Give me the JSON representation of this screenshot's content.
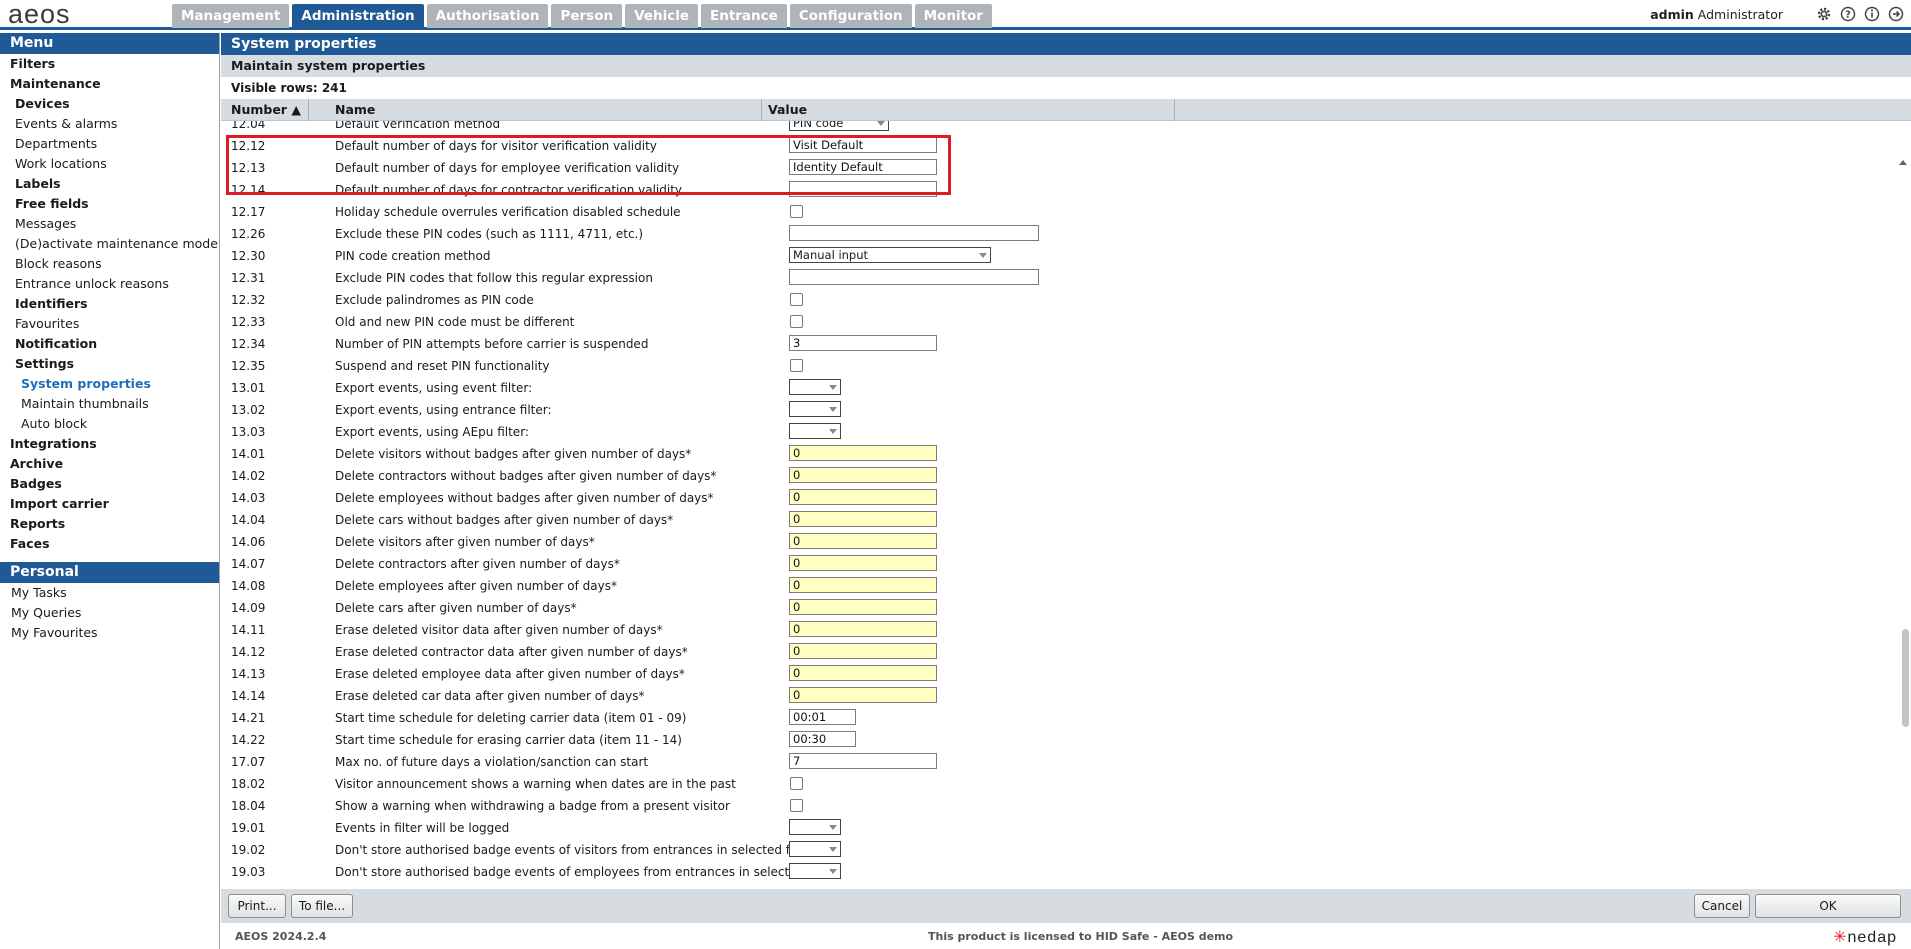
{
  "app": {
    "logo": "aeos",
    "tabs": [
      {
        "label": "Management",
        "active": false
      },
      {
        "label": "Administration",
        "active": true
      },
      {
        "label": "Authorisation",
        "active": false
      },
      {
        "label": "Person",
        "active": false
      },
      {
        "label": "Vehicle",
        "active": false
      },
      {
        "label": "Entrance",
        "active": false
      },
      {
        "label": "Configuration",
        "active": false
      },
      {
        "label": "Monitor",
        "active": false
      }
    ],
    "user": {
      "login": "admin",
      "role": "Administrator"
    },
    "icons": [
      "gear-icon",
      "help-icon",
      "info-icon",
      "logout-icon"
    ],
    "accent_color": "#1f5a96",
    "highlight_color": "#e01b24"
  },
  "sidebar": {
    "menu_title": "Menu",
    "items": [
      {
        "label": "Filters",
        "level": "l0"
      },
      {
        "label": "Maintenance",
        "level": "l0"
      },
      {
        "label": "Devices",
        "level": "l1b"
      },
      {
        "label": "Events & alarms",
        "level": "l1"
      },
      {
        "label": "Departments",
        "level": "l1"
      },
      {
        "label": "Work locations",
        "level": "l1"
      },
      {
        "label": "Labels",
        "level": "l1b"
      },
      {
        "label": "Free fields",
        "level": "l1b"
      },
      {
        "label": "Messages",
        "level": "l1"
      },
      {
        "label": "(De)activate maintenance mode",
        "level": "l1"
      },
      {
        "label": "Block reasons",
        "level": "l1"
      },
      {
        "label": "Entrance unlock reasons",
        "level": "l1"
      },
      {
        "label": "Identifiers",
        "level": "l1b"
      },
      {
        "label": "Favourites",
        "level": "l1"
      },
      {
        "label": "Notification",
        "level": "l1b"
      },
      {
        "label": "Settings",
        "level": "l1b"
      },
      {
        "label": "System properties",
        "level": "l2",
        "active": true
      },
      {
        "label": "Maintain thumbnails",
        "level": "l2"
      },
      {
        "label": "Auto block",
        "level": "l2"
      },
      {
        "label": "Integrations",
        "level": "l0"
      },
      {
        "label": "Archive",
        "level": "l0"
      },
      {
        "label": "Badges",
        "level": "l0"
      },
      {
        "label": "Import carrier",
        "level": "l0"
      },
      {
        "label": "Reports",
        "level": "l0"
      },
      {
        "label": "Faces",
        "level": "l0"
      }
    ],
    "personal_title": "Personal",
    "personal_items": [
      "My Tasks",
      "My Queries",
      "My Favourites"
    ]
  },
  "main": {
    "title": "System properties",
    "subtitle": "Maintain system properties",
    "visible_rows": "Visible rows: 241",
    "columns": {
      "number": "Number ▲",
      "name": "Name",
      "value": "Value"
    },
    "rows": [
      {
        "num": "12.04",
        "name": "Default verification method",
        "type": "select",
        "value": "PIN code",
        "w": 100,
        "partial": true
      },
      {
        "num": "12.12",
        "name": "Default number of days for visitor verification validity",
        "type": "text",
        "value": "Visit Default",
        "w": 148
      },
      {
        "num": "12.13",
        "name": "Default number of days for employee verification validity",
        "type": "text",
        "value": "Identity Default",
        "w": 148
      },
      {
        "num": "12.14",
        "name": "Default number of days for contractor verification validity",
        "type": "text",
        "value": "",
        "w": 148,
        "partial": true
      },
      {
        "num": "12.17",
        "name": "Holiday schedule overrules verification disabled schedule",
        "type": "check",
        "value": ""
      },
      {
        "num": "12.26",
        "name": "Exclude these PIN codes (such as 1111, 4711, etc.)",
        "type": "text",
        "value": "",
        "w": 250
      },
      {
        "num": "12.30",
        "name": "PIN code creation method",
        "type": "select",
        "value": "Manual input",
        "w": 202
      },
      {
        "num": "12.31",
        "name": "Exclude PIN codes that follow this regular expression",
        "type": "text",
        "value": "",
        "w": 250
      },
      {
        "num": "12.32",
        "name": "Exclude palindromes as PIN code",
        "type": "check",
        "value": ""
      },
      {
        "num": "12.33",
        "name": "Old and new PIN code must be different",
        "type": "check",
        "value": ""
      },
      {
        "num": "12.34",
        "name": "Number of PIN attempts before carrier is suspended",
        "type": "text",
        "value": "3",
        "w": 148
      },
      {
        "num": "12.35",
        "name": "Suspend and reset PIN functionality",
        "type": "check",
        "value": ""
      },
      {
        "num": "13.01",
        "name": "Export events, using event filter:",
        "type": "select",
        "value": "",
        "w": 52
      },
      {
        "num": "13.02",
        "name": "Export events, using entrance filter:",
        "type": "select",
        "value": "",
        "w": 52
      },
      {
        "num": "13.03",
        "name": "Export events, using AEpu filter:",
        "type": "select",
        "value": "",
        "w": 52
      },
      {
        "num": "14.01",
        "name": "Delete visitors without badges after given number of days*",
        "type": "yellow",
        "value": "0",
        "w": 148
      },
      {
        "num": "14.02",
        "name": "Delete contractors without badges after given number of days*",
        "type": "yellow",
        "value": "0",
        "w": 148
      },
      {
        "num": "14.03",
        "name": "Delete employees without badges after given number of days*",
        "type": "yellow",
        "value": "0",
        "w": 148
      },
      {
        "num": "14.04",
        "name": "Delete cars without badges after given number of days*",
        "type": "yellow",
        "value": "0",
        "w": 148
      },
      {
        "num": "14.06",
        "name": "Delete visitors after given number of days*",
        "type": "yellow",
        "value": "0",
        "w": 148
      },
      {
        "num": "14.07",
        "name": "Delete contractors after given number of days*",
        "type": "yellow",
        "value": "0",
        "w": 148
      },
      {
        "num": "14.08",
        "name": "Delete employees after given number of days*",
        "type": "yellow",
        "value": "0",
        "w": 148
      },
      {
        "num": "14.09",
        "name": "Delete cars after given number of days*",
        "type": "yellow",
        "value": "0",
        "w": 148
      },
      {
        "num": "14.11",
        "name": "Erase deleted visitor data after given number of days*",
        "type": "yellow",
        "value": "0",
        "w": 148
      },
      {
        "num": "14.12",
        "name": "Erase deleted contractor data after given number of days*",
        "type": "yellow",
        "value": "0",
        "w": 148
      },
      {
        "num": "14.13",
        "name": "Erase deleted employee data after given number of days*",
        "type": "yellow",
        "value": "0",
        "w": 148
      },
      {
        "num": "14.14",
        "name": "Erase deleted car data after given number of days*",
        "type": "yellow",
        "value": "0",
        "w": 148
      },
      {
        "num": "14.21",
        "name": "Start time schedule for deleting carrier data (item 01 - 09)",
        "type": "text",
        "value": "00:01",
        "w": 67
      },
      {
        "num": "14.22",
        "name": "Start time schedule for erasing carrier data (item 11 - 14)",
        "type": "text",
        "value": "00:30",
        "w": 67
      },
      {
        "num": "17.07",
        "name": "Max no. of future days a violation/sanction can start",
        "type": "text",
        "value": "7",
        "w": 148
      },
      {
        "num": "18.02",
        "name": "Visitor announcement shows a warning when dates are in the past",
        "type": "check",
        "value": ""
      },
      {
        "num": "18.04",
        "name": "Show a warning when withdrawing a badge from a present visitor",
        "type": "check",
        "value": ""
      },
      {
        "num": "19.01",
        "name": "Events in filter will be logged",
        "type": "select",
        "value": "",
        "w": 52
      },
      {
        "num": "19.02",
        "name": "Don't store authorised badge events of visitors from entrances in selected filter",
        "type": "select",
        "value": "",
        "w": 52
      },
      {
        "num": "19.03",
        "name": "Don't store authorised badge events of employees from entrances in selected…",
        "type": "select",
        "value": "",
        "w": 52
      }
    ]
  },
  "buttons": {
    "print": "Print...",
    "to_file": "To file...",
    "cancel": "Cancel",
    "ok": "OK"
  },
  "footer": {
    "version": "AEOS 2024.2.4",
    "license": "This product is licensed to HID Safe - AEOS demo",
    "brand": "nedap"
  }
}
